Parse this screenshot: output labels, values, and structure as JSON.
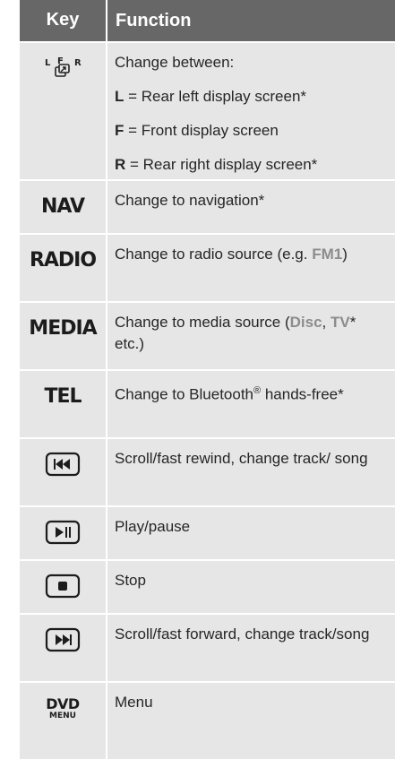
{
  "header": {
    "key": "Key",
    "function": "Function"
  },
  "rows": [
    {
      "lrf_icon": {
        "left": "L",
        "front": "F",
        "right": "R"
      },
      "intro": "Change between:",
      "items": [
        {
          "letter": "L",
          "text": " = Rear left display screen*"
        },
        {
          "letter": "F",
          "text": " = Front display screen"
        },
        {
          "letter": "R",
          "text": " = Rear right display screen*"
        }
      ]
    },
    {
      "key_label": "NAV",
      "function": "Change to navigation*"
    },
    {
      "key_label": "RADIO",
      "function_pre": "Change to radio source (e.g. ",
      "function_hl": "FM1",
      "function_post": ")"
    },
    {
      "key_label": "MEDIA",
      "function_pre": "Change to media source (",
      "function_hl1": "Disc",
      "function_mid": ", ",
      "function_hl2": "TV",
      "function_post": "* etc.)"
    },
    {
      "key_label": "TEL",
      "function_pre": "Change to Bluetooth",
      "function_sup": "®",
      "function_post": " hands-free*"
    },
    {
      "icon": "rewind-button-icon",
      "function": "Scroll/fast rewind, change track/ song"
    },
    {
      "icon": "play-pause-button-icon",
      "function": "Play/pause"
    },
    {
      "icon": "stop-button-icon",
      "function": "Stop"
    },
    {
      "icon": "fast-forward-button-icon",
      "function": "Scroll/fast forward, change track/song"
    },
    {
      "dvd_icon": {
        "top": "DVD",
        "bottom": "MENU"
      },
      "function": "Menu"
    }
  ],
  "colors": {
    "header_bg": "#676767",
    "row_bg": "#e6e6e6",
    "highlight": "#8c8c8c"
  }
}
